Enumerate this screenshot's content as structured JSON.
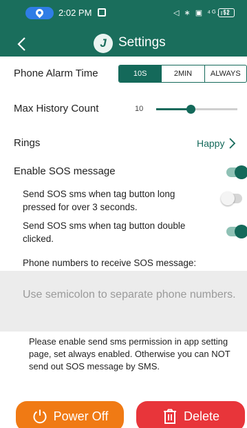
{
  "status_bar": {
    "time": "2:02 PM",
    "right_icons": "◁ ∗ ▣ ⁴ᴳ.ıll",
    "battery": "52"
  },
  "header": {
    "back_icon": "chevron-left-icon",
    "logo_icon": "app-logo-icon",
    "title": "Settings"
  },
  "alarm_time": {
    "label": "Phone Alarm Time",
    "options": [
      "10S",
      "2MIN",
      "ALWAYS"
    ],
    "selected_index": 0
  },
  "history": {
    "label": "Max History Count",
    "value": "10",
    "slider_fraction": 0.42
  },
  "rings": {
    "label": "Rings",
    "value": "Happy"
  },
  "sos": {
    "label": "Enable SOS message",
    "enabled": true,
    "long_press_label": "Send SOS sms when tag button long pressed for over 3 seconds.",
    "long_press_enabled": false,
    "double_click_label": "Send SOS sms when tag button double clicked.",
    "double_click_enabled": true,
    "phone_label": "Phone numbers to receive SOS message:",
    "phone_placeholder": "Use semicolon to separate phone numbers.",
    "note": "Please enable send sms permission in app setting page, set always enabled. Otherwise you can NOT send out SOS message by SMS."
  },
  "actions": {
    "power_off": "Power Off",
    "power_icon": "power-icon",
    "delete": "Delete",
    "delete_icon": "trash-icon"
  },
  "colors": {
    "primary": "#1a6e5c",
    "power_button": "#f07a14",
    "delete_button": "#e8353a"
  }
}
